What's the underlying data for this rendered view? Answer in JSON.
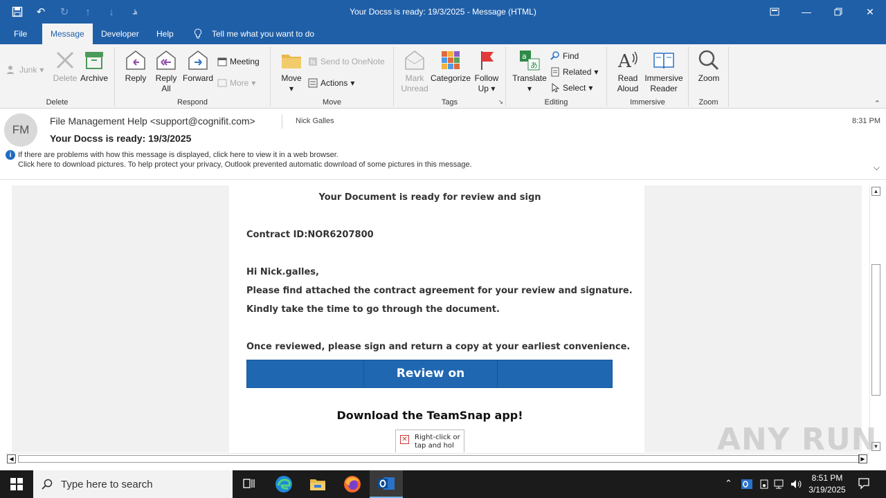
{
  "window": {
    "title": "Your Docss is ready: 19/3/2025  -  Message (HTML)"
  },
  "menu": {
    "tabs": [
      "File",
      "Message",
      "Developer",
      "Help"
    ],
    "tell_me": "Tell me what you want to do"
  },
  "ribbon": {
    "delete_group": {
      "junk": "Junk",
      "delete": "Delete",
      "archive": "Archive",
      "label": "Delete"
    },
    "respond_group": {
      "reply": "Reply",
      "reply_all_1": "Reply",
      "reply_all_2": "All",
      "forward": "Forward",
      "meeting": "Meeting",
      "more": "More",
      "label": "Respond"
    },
    "move_group": {
      "move": "Move",
      "send_onenote": "Send to OneNote",
      "actions": "Actions",
      "label": "Move"
    },
    "tags_group": {
      "mark_1": "Mark",
      "mark_2": "Unread",
      "categorize": "Categorize",
      "follow_1": "Follow",
      "follow_2": "Up",
      "label": "Tags"
    },
    "editing_group": {
      "translate": "Translate",
      "find": "Find",
      "related": "Related",
      "select": "Select",
      "label": "Editing"
    },
    "immersive_group": {
      "read_1": "Read",
      "read_2": "Aloud",
      "immersive_1": "Immersive",
      "immersive_2": "Reader",
      "label": "Immersive"
    },
    "zoom_group": {
      "zoom": "Zoom",
      "label": "Zoom"
    }
  },
  "message": {
    "avatar_initials": "FM",
    "sender": "File Management Help <support@cognifit.com>",
    "recipient": "Nick Galles",
    "time": "8:31 PM",
    "subject": "Your Docss is ready: 19/3/2025",
    "info_line_1": "If there are problems with how this message is displayed, click here to view it in a web browser.",
    "info_line_2": "Click here to download pictures. To help protect your privacy, Outlook prevented automatic download of some pictures in this message."
  },
  "email_body": {
    "heading": "Your Document is ready for review and sign",
    "contract": "Contract ID:NOR6207800",
    "greeting": "Hi Nick.galles,",
    "line1": "Please find attached the contract agreement for your review and signature.",
    "line2": "Kindly take the time to go through the document.",
    "line3": "Once reviewed, please sign and return a copy at your earliest convenience.",
    "cta": "Review on Docusign",
    "app_title": "Download the TeamSnap app!",
    "img_placeholder_1": "Right-click or",
    "img_placeholder_2": "tap and hol"
  },
  "watermark": "ANY RUN",
  "taskbar": {
    "search_placeholder": "Type here to search",
    "time": "8:51 PM",
    "date": "3/19/2025"
  },
  "colors": {
    "brand": "#1f5fa8",
    "cta": "#1f67b1",
    "taskbar": "#1b1b1b"
  }
}
